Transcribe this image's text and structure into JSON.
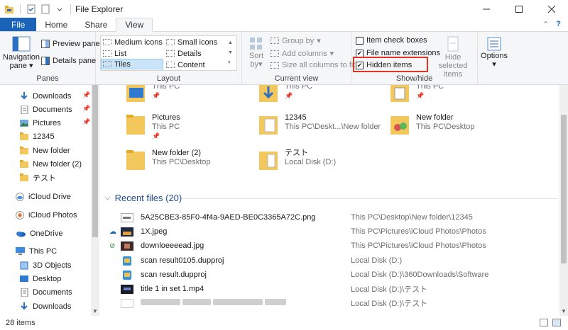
{
  "window": {
    "title": "File Explorer"
  },
  "tabs": [
    {
      "label": "File"
    },
    {
      "label": "Home"
    },
    {
      "label": "Share"
    },
    {
      "label": "View"
    }
  ],
  "ribbon": {
    "panes": {
      "group_label": "Panes",
      "navigation_pane": "Navigation",
      "navigation_pane_2": "pane",
      "preview_pane": "Preview pane",
      "details_pane": "Details pane"
    },
    "layout": {
      "group_label": "Layout",
      "items": [
        "Medium icons",
        "Small icons",
        "List",
        "Details",
        "Tiles",
        "Content"
      ],
      "selected": "Tiles"
    },
    "current_view": {
      "group_label": "Current view",
      "sort_by": "Sort",
      "sort_by_2": "by",
      "group_by": "Group by",
      "add_columns": "Add columns",
      "size_all_columns": "Size all columns to fit"
    },
    "show_hide": {
      "group_label": "Show/hide",
      "item_check_boxes": {
        "label": "Item check boxes",
        "checked": false
      },
      "file_name_extensions": {
        "label": "File name extensions",
        "checked": true
      },
      "hidden_items": {
        "label": "Hidden items",
        "checked": true
      },
      "hide_selected": "Hide selected",
      "hide_selected_2": "items"
    },
    "options": {
      "label": "Options"
    }
  },
  "nav": {
    "items": [
      {
        "label": "Downloads",
        "icon": "download-icon",
        "pinned": true
      },
      {
        "label": "Documents",
        "icon": "documents-icon",
        "pinned": true
      },
      {
        "label": "Pictures",
        "icon": "pictures-icon",
        "pinned": true
      },
      {
        "label": "12345",
        "icon": "folder-icon",
        "pinned": false
      },
      {
        "label": "New folder",
        "icon": "folder-icon",
        "pinned": false
      },
      {
        "label": "New folder (2)",
        "icon": "folder-icon",
        "pinned": false
      },
      {
        "label": "テスト",
        "icon": "folder-icon",
        "pinned": false
      },
      {
        "label": "iCloud Drive",
        "icon": "icloud-drive-icon",
        "pinned": false
      },
      {
        "label": "iCloud Photos",
        "icon": "icloud-photos-icon",
        "pinned": false
      },
      {
        "label": "OneDrive",
        "icon": "onedrive-icon",
        "pinned": false
      },
      {
        "label": "This PC",
        "icon": "this-pc-icon",
        "pinned": false
      },
      {
        "label": "3D Objects",
        "icon": "3d-objects-icon",
        "pinned": false
      },
      {
        "label": "Desktop",
        "icon": "desktop-icon",
        "pinned": false
      },
      {
        "label": "Documents",
        "icon": "documents-icon",
        "pinned": false
      },
      {
        "label": "Downloads",
        "icon": "download-icon",
        "pinned": false
      }
    ]
  },
  "quick_access": {
    "tiles": [
      {
        "name": "",
        "location": "This PC",
        "pinned": true,
        "icon": "desktop-folder-icon"
      },
      {
        "name": "",
        "location": "This PC",
        "pinned": true,
        "icon": "downloads-folder-icon"
      },
      {
        "name": "",
        "location": "This PC",
        "pinned": true,
        "icon": "documents-folder-icon"
      },
      {
        "name": "Pictures",
        "location": "This PC",
        "pinned": true,
        "icon": "pictures-folder-icon"
      },
      {
        "name": "12345",
        "location": "This PC\\Deskt...\\New folder",
        "pinned": false,
        "icon": "folder-icon"
      },
      {
        "name": "New folder",
        "location": "This PC\\Desktop",
        "pinned": false,
        "icon": "folder-icon"
      },
      {
        "name": "New folder (2)",
        "location": "This PC\\Desktop",
        "pinned": false,
        "icon": "folder-icon"
      },
      {
        "name": "テスト",
        "location": "Local Disk (D:)",
        "pinned": false,
        "icon": "folder-icon"
      }
    ]
  },
  "recent": {
    "header": "Recent files (20)",
    "files": [
      {
        "name": "5A25CBE3-85F0-4f4a-9AED-BE0C3365A72C.png",
        "location": "This PC\\Desktop\\New folder\\12345",
        "status": ""
      },
      {
        "name": "1X.jpeg",
        "location": "This PC\\Pictures\\iCloud Photos\\Photos",
        "status": "cloud"
      },
      {
        "name": "downloeeeead.jpg",
        "location": "This PC\\Pictures\\iCloud Photos\\Photos",
        "status": "synced"
      },
      {
        "name": "scan result0105.dupproj",
        "location": "Local Disk (D:)",
        "status": ""
      },
      {
        "name": "scan result.dupproj",
        "location": "Local Disk (D:)\\360Downloads\\Software",
        "status": ""
      },
      {
        "name": "title 1 in set 1.mp4",
        "location": "Local Disk (D:)\\テスト",
        "status": ""
      },
      {
        "name": "",
        "location": "Local Disk (D:)\\テスト",
        "status": ""
      }
    ]
  },
  "status": {
    "item_count": "28 items"
  },
  "colors": {
    "accent": "#1a63b8",
    "highlight": "#e53322",
    "folder": "#f2c75c"
  }
}
